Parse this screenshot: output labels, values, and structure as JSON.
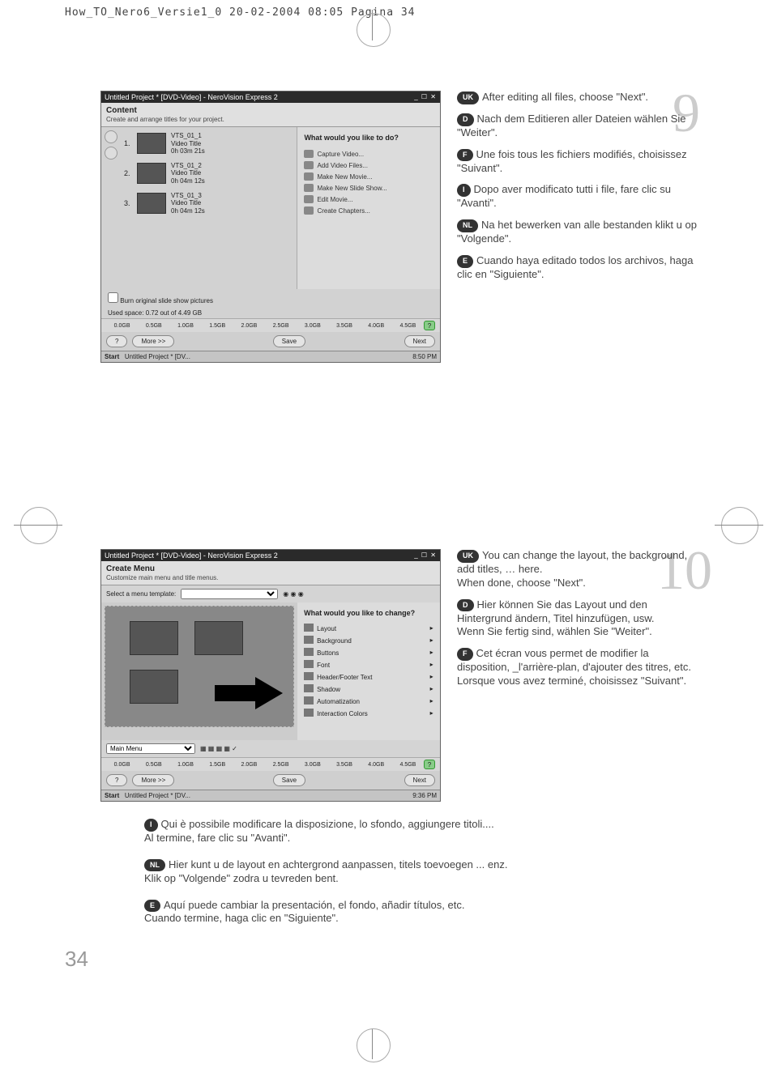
{
  "print_header": "How_TO_Nero6_Versie1_0   20-02-2004   08:05   Pagina 34",
  "page_number": "34",
  "step9_num": "9",
  "step10_num": "10",
  "screenshot1": {
    "title": "Untitled Project * [DVD-Video] - NeroVision Express 2",
    "header": "Content",
    "subheader": "Create and arrange titles for your project.",
    "clips": [
      {
        "n": "1.",
        "name": "VTS_01_1",
        "sub": "Video Title",
        "dur": "0h 03m 21s"
      },
      {
        "n": "2.",
        "name": "VTS_01_2",
        "sub": "Video Title",
        "dur": "0h 04m 12s"
      },
      {
        "n": "3.",
        "name": "VTS_01_3",
        "sub": "Video Title",
        "dur": "0h 04m 12s"
      }
    ],
    "right_header": "What would you like to do?",
    "actions": [
      "Capture Video...",
      "Add Video Files...",
      "Make New Movie...",
      "Make New Slide Show...",
      "Edit Movie...",
      "Create Chapters..."
    ],
    "checkbox": "Burn original slide show pictures",
    "used": "Used space: 0.72 out of 4.49 GB",
    "ruler": [
      "0.0GB",
      "0.5GB",
      "1.0GB",
      "1.5GB",
      "2.0GB",
      "2.5GB",
      "3.0GB",
      "3.5GB",
      "4.0GB",
      "4.5GB"
    ],
    "more": "More >>",
    "save": "Save",
    "next": "Next",
    "taskbar_start": "Start",
    "taskbar_item": "Untitled Project * [DV...",
    "taskbar_time": "8:50 PM"
  },
  "screenshot2": {
    "title": "Untitled Project * [DVD-Video] - NeroVision Express 2",
    "header": "Create Menu",
    "subheader": "Customize main menu and title menus.",
    "template_label": "Select a menu template:",
    "right_header": "What would you like to change?",
    "options": [
      "Layout",
      "Background",
      "Buttons",
      "Font",
      "Header/Footer Text",
      "Shadow",
      "Automatization",
      "Interaction Colors"
    ],
    "main_menu": "Main Menu",
    "ruler": [
      "0.0GB",
      "0.5GB",
      "1.0GB",
      "1.5GB",
      "2.0GB",
      "2.5GB",
      "3.0GB",
      "3.5GB",
      "4.0GB",
      "4.5GB"
    ],
    "more": "More >>",
    "save": "Save",
    "next": "Next",
    "taskbar_start": "Start",
    "taskbar_item": "Untitled Project * [DV...",
    "taskbar_time": "9:36 PM"
  },
  "step9_text": {
    "uk": "After editing all files, choose \"Next\".",
    "d": "Nach dem Editieren aller Dateien wählen Sie \"Weiter\".",
    "f": "Une fois tous les fichiers modifiés, choisissez \"Suivant\".",
    "i": "Dopo aver modificato tutti i file, fare clic su \"Avanti\".",
    "nl": "Na het bewerken van alle bestanden klikt u op \"Volgende\".",
    "e": "Cuando haya editado todos los archivos, haga clic en \"Siguiente\"."
  },
  "step10_text": {
    "uk_a": "You can change the layout, the background, add titles, … here.",
    "uk_b": "When done, choose \"Next\".",
    "d_a": "Hier können Sie das Layout und den Hintergrund ändern, Titel hinzufügen, usw.",
    "d_b": "Wenn Sie fertig sind, wählen Sie \"Weiter\".",
    "f_a": "Cet écran vous permet de modifier la disposition, _l'arrière-plan, d'ajouter des titres, etc.",
    "f_b": "Lorsque vous avez terminé, choisissez \"Suivant\".",
    "i_a": "Qui è possibile modificare la disposizione, lo sfondo, aggiungere titoli....",
    "i_b": "Al termine, fare clic su \"Avanti\".",
    "nl_a": "Hier kunt u de layout en achtergrond aanpassen, titels toevoegen ... enz.",
    "nl_b": "Klik op \"Volgende\" zodra u tevreden bent.",
    "e_a": "Aquí puede cambiar la presentación, el fondo, añadir títulos, etc.",
    "e_b": "Cuando termine, haga clic en \"Siguiente\"."
  },
  "pills": {
    "uk": "UK",
    "d": "D",
    "f": "F",
    "i": "I",
    "nl": "NL",
    "e": "E"
  }
}
